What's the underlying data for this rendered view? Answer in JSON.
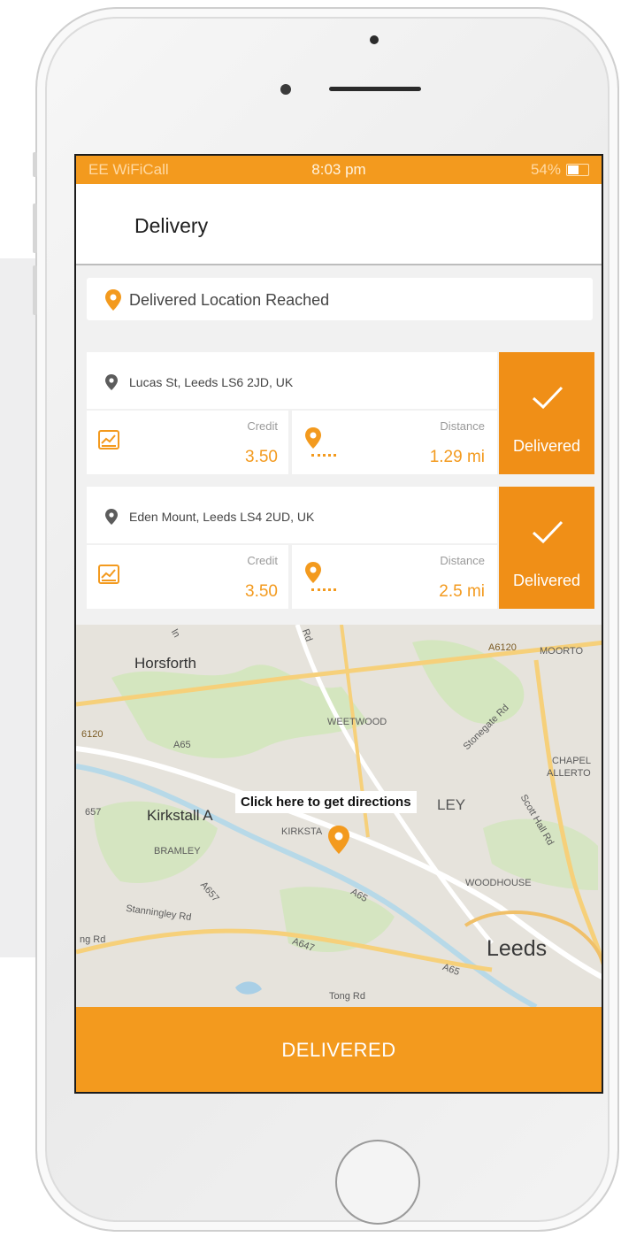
{
  "status_bar": {
    "carrier": "EE WiFiCall",
    "time": "8:03 pm",
    "battery": "54%"
  },
  "header": {
    "title": "Delivery"
  },
  "location_banner": {
    "text": "Delivered Location Reached"
  },
  "deliveries": [
    {
      "address": "Lucas St, Leeds LS6 2JD, UK",
      "credit_label": "Credit",
      "credit_value": "3.50",
      "distance_label": "Distance",
      "distance_value": "1.29 mi",
      "status_button": "Delivered"
    },
    {
      "address": "Eden Mount, Leeds LS4 2UD, UK",
      "credit_label": "Credit",
      "credit_value": "3.50",
      "distance_label": "Distance",
      "distance_value": "2.5 mi",
      "status_button": "Delivered"
    }
  ],
  "map": {
    "tooltip": "Click here to get directions",
    "labels": {
      "horsforth": "Horsforth",
      "weetwood": "WEETWOOD",
      "a6120_top": "A6120",
      "moortown": "MOORTO",
      "a6120_left": "6120",
      "a65_top": "A65",
      "stonegate": "Stonegate Rd",
      "chapel": "CHAPEL",
      "allerton": "ALLERTO",
      "kirkstall_abbey": "Kirkstall A",
      "a657": "657",
      "kirkstall": "KIRKSTA",
      "headingley": "LEY",
      "scott_hall": "Scott Hall Rd",
      "bramley": "BRAMLEY",
      "a657b": "A657",
      "stanningley": "Stanningley Rd",
      "a65_mid": "A65",
      "woodhouse": "WOODHOUSE",
      "rd_left": "ng Rd",
      "a647": "A647",
      "a65_low": "A65",
      "leeds": "Leeds",
      "tong": "Tong Rd",
      "rd_top": "Rd",
      "rd_top2": "ln"
    }
  },
  "footer": {
    "button": "DELIVERED"
  },
  "colors": {
    "accent": "#f39a1e"
  }
}
